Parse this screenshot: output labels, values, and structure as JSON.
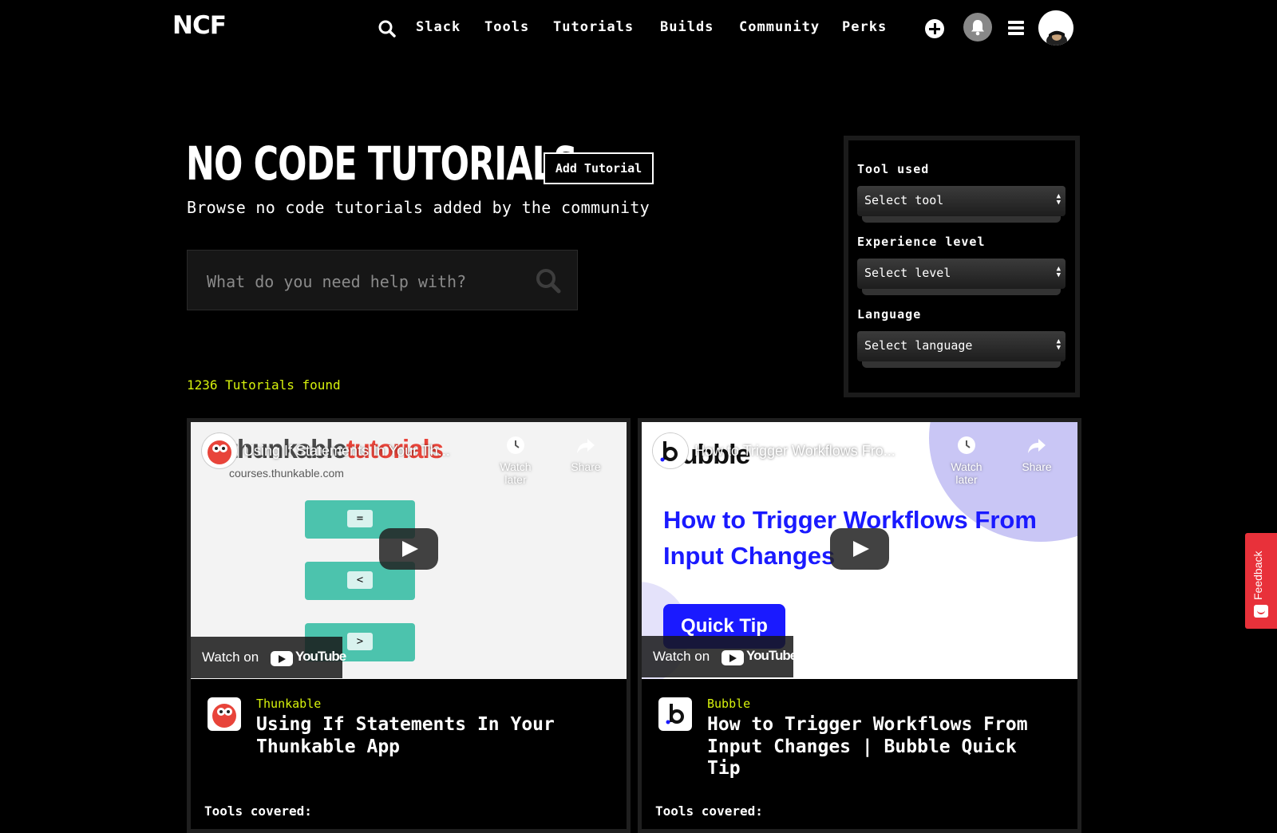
{
  "header": {
    "logo": "NCF",
    "nav": [
      "Slack",
      "Tools",
      "Tutorials",
      "Builds",
      "Community",
      "Perks"
    ]
  },
  "hero": {
    "title": "NO CODE TUTORIALS",
    "title_dot": ".",
    "add_button": "Add Tutorial",
    "subtitle": "Browse no code tutorials added by the community"
  },
  "search": {
    "placeholder": "What do you need help with?",
    "value": ""
  },
  "results": {
    "count_text": "1236 Tutorials found"
  },
  "filters": [
    {
      "label": "Tool used",
      "selected": "Select tool"
    },
    {
      "label": "Experience level",
      "selected": "Select level"
    },
    {
      "label": "Language",
      "selected": "Select language"
    }
  ],
  "video_controls": {
    "watch_later": "Watch later",
    "share": "Share",
    "watch_on": "Watch on",
    "youtube": "YouTube"
  },
  "cards": [
    {
      "video_title": "Using If Statements In Your Th...",
      "video_brand": "thunkable",
      "video_brand_suffix": "tutorials",
      "video_url_text": "courses.thunkable.com",
      "blocks": [
        "=",
        "<",
        ">"
      ],
      "tool_name": "Thunkable",
      "title": "Using If Statements In Your Thunkable App",
      "tools_covered_label": "Tools covered:"
    },
    {
      "video_title": "How to Trigger Workflows Fro...",
      "video_brand": "bubble",
      "video_headline": "How to Trigger Workflows From Input Changes",
      "video_button": "Quick Tip",
      "tool_name": "Bubble",
      "title": "How to Trigger Workflows From Input Changes | Bubble Quick Tip",
      "tools_covered_label": "Tools covered:"
    }
  ],
  "feedback": {
    "label": "Feedback"
  },
  "colors": {
    "accent": "#d7f20c",
    "background": "#000000",
    "thunkable_red": "#e8443a",
    "thunkable_teal": "#4cc3ad",
    "bubble_blue": "#1a1aff",
    "feedback_red": "#e8313a"
  }
}
